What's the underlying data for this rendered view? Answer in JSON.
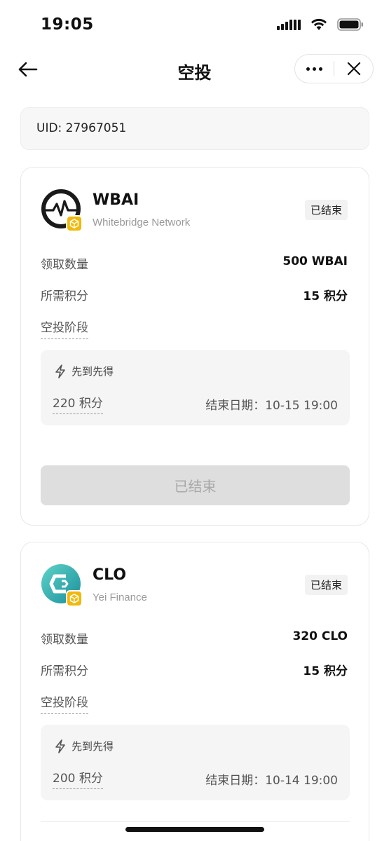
{
  "status_bar": {
    "time": "19:05"
  },
  "nav": {
    "title": "空投"
  },
  "account": {
    "uid": "UID: 27967051"
  },
  "airdrops": [
    {
      "symbol": "WBAI",
      "project": "Whitebridge Network",
      "status": "已结束",
      "claim_label": "领取数量",
      "claim_value": "500 WBAI",
      "points_label": "所需积分",
      "points_value": "15 积分",
      "stage_label": "空投阶段",
      "stage": {
        "type": "先到先得",
        "points": "220 积分",
        "end": "结束日期：10-15 19:00"
      },
      "button_label": "已结束",
      "logo_color": "#1a1a1a"
    },
    {
      "symbol": "CLO",
      "project": "Yei Finance",
      "status": "已结束",
      "claim_label": "领取数量",
      "claim_value": "320 CLO",
      "points_label": "所需积分",
      "points_value": "15 积分",
      "stage_label": "空投阶段",
      "stage": {
        "type": "先到先得",
        "points": "200 积分",
        "end": "结束日期：10-14 19:00"
      },
      "logo_color": "#1e9fa3"
    }
  ],
  "icons": {
    "back": "arrow-left-icon",
    "more": "more-dots-icon",
    "close": "close-icon",
    "lightning": "lightning-icon",
    "badge": "bnb-badge-icon"
  },
  "colors": {
    "badge": "#f0b90b",
    "button_disabled": "#dedede"
  }
}
